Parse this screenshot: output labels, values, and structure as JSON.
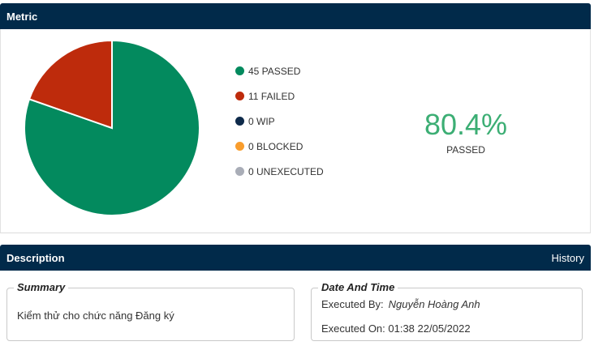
{
  "metric": {
    "header": "Metric",
    "legend": [
      {
        "label": "45 PASSED",
        "color": "#038a5e",
        "icon": "dot-icon"
      },
      {
        "label": "11 FAILED",
        "color": "#be2b0c",
        "icon": "dot-icon"
      },
      {
        "label": "0 WIP",
        "color": "#0e2a4a",
        "icon": "dot-icon"
      },
      {
        "label": "0 BLOCKED",
        "color": "#f99d2d",
        "icon": "dot-icon"
      },
      {
        "label": "0 UNEXECUTED",
        "color": "#a9adb7",
        "icon": "dot-icon"
      }
    ],
    "percent": "80.4%",
    "percent_label": "PASSED"
  },
  "chart_data": {
    "type": "pie",
    "categories": [
      "PASSED",
      "FAILED",
      "WIP",
      "BLOCKED",
      "UNEXECUTED"
    ],
    "values": [
      45,
      11,
      0,
      0,
      0
    ],
    "colors": [
      "#038a5e",
      "#be2b0c",
      "#0e2a4a",
      "#f99d2d",
      "#a9adb7"
    ]
  },
  "description": {
    "header": "Description",
    "history_link": "History",
    "summary": {
      "title": "Summary",
      "text": "Kiểm thử cho chức năng Đăng ký"
    },
    "datetime": {
      "title": "Date And Time",
      "executed_by_label": "Executed By:",
      "executed_by": "Nguyễn Hoàng Anh",
      "executed_on": "Executed On: 01:38 22/05/2022"
    }
  }
}
